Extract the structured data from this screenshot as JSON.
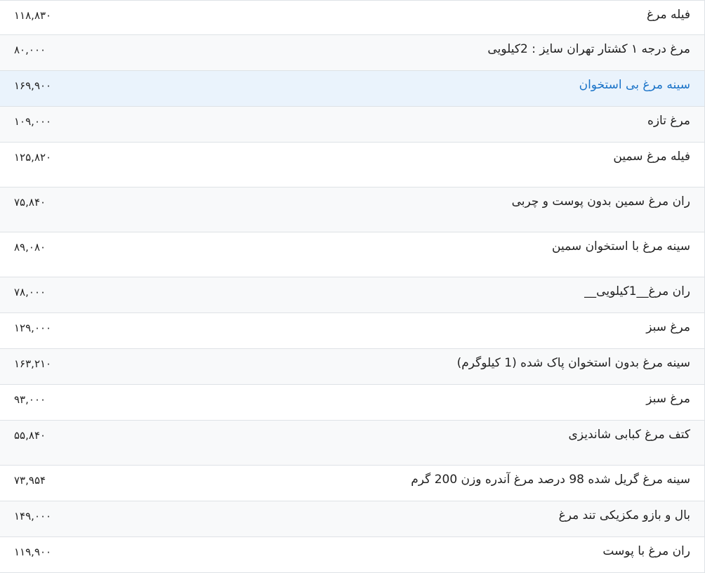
{
  "rows": [
    {
      "name": "فیله مرغ",
      "price": "۱۱۸,۸۳۰"
    },
    {
      "name": "مرغ درجه ۱ کشتار تهران سایز : 2کیلویی",
      "price": "۸۰,۰۰۰"
    },
    {
      "name": "سینه مرغ بی استخوان",
      "price": "۱۶۹,۹۰۰"
    },
    {
      "name": "مرغ تازه",
      "price": "۱۰۹,۰۰۰"
    },
    {
      "name": "فیله مرغ سمین",
      "price": "۱۲۵,۸۲۰"
    },
    {
      "name": "ران مرغ سمین بدون پوست و چربی",
      "price": "۷۵,۸۴۰"
    },
    {
      "name": "سینه مرغ با استخوان سمین",
      "price": "۸۹,۰۸۰"
    },
    {
      "name": "ران مرغ__1کیلویی__",
      "price": "۷۸,۰۰۰"
    },
    {
      "name": "مرغ سبز",
      "price": "۱۲۹,۰۰۰"
    },
    {
      "name": "سینه مرغ بدون استخوان پاک شده (1 کیلوگرم)",
      "price": "۱۶۳,۲۱۰"
    },
    {
      "name": "مرغ سبز",
      "price": "۹۳,۰۰۰"
    },
    {
      "name": "کتف مرغ کبابی شاندیزی",
      "price": "۵۵,۸۴۰"
    },
    {
      "name": "سینه مرغ گریل شده 98 درصد مرغ آندره وزن 200 گرم",
      "price": "۷۳,۹۵۴"
    },
    {
      "name": "بال و بازو مکزیکی تند مرغ",
      "price": "۱۴۹,۰۰۰"
    },
    {
      "name": "ران مرغ با پوست",
      "price": "۱۱۹,۹۰۰"
    }
  ]
}
